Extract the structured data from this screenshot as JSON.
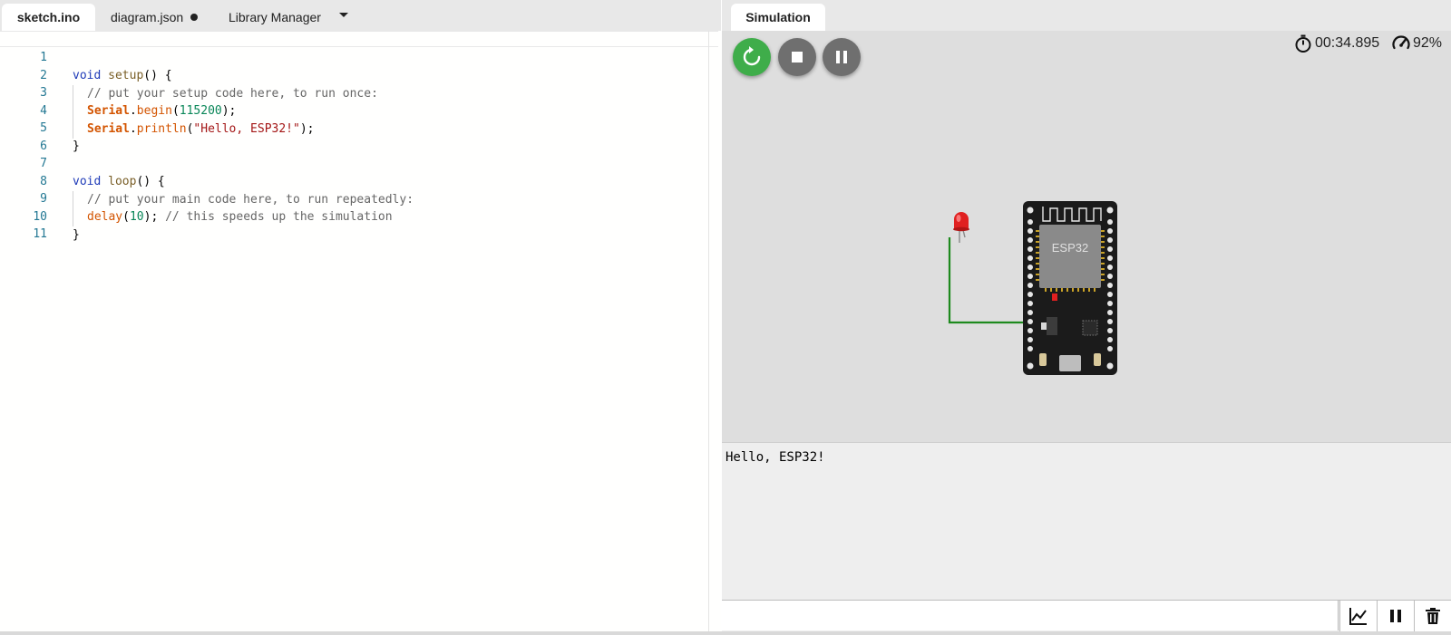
{
  "editor": {
    "tabs": [
      {
        "label": "sketch.ino"
      },
      {
        "label": "diagram.json"
      },
      {
        "label": "Library Manager"
      }
    ],
    "lines": [
      {
        "n": "1"
      },
      {
        "n": "2"
      },
      {
        "n": "3"
      },
      {
        "n": "4"
      },
      {
        "n": "5"
      },
      {
        "n": "6"
      },
      {
        "n": "7"
      },
      {
        "n": "8"
      },
      {
        "n": "9"
      },
      {
        "n": "10"
      },
      {
        "n": "11"
      }
    ],
    "code": {
      "l1_kw": "void",
      "l1_fn": "setup",
      "l1_rest": "() {",
      "l2_comment": "// put your setup code here, to run once:",
      "l3_class": "Serial",
      "l3_dot": ".",
      "l3_method": "begin",
      "l3_open": "(",
      "l3_num": "115200",
      "l3_close": ");",
      "l4_class": "Serial",
      "l4_dot": ".",
      "l4_method": "println",
      "l4_open": "(",
      "l4_str": "\"Hello, ESP32!\"",
      "l4_close": ");",
      "l5": "}",
      "l7_kw": "void",
      "l7_fn": "loop",
      "l7_rest": "() {",
      "l8_comment": "// put your main code here, to run repeatedly:",
      "l9_fn": "delay",
      "l9_open": "(",
      "l9_num": "10",
      "l9_close": ");",
      "l9_comment": " // this speeds up the simulation",
      "l10": "}"
    }
  },
  "simulation": {
    "tab_label": "Simulation",
    "timer": "00:34.895",
    "speed": "92%",
    "board_label": "ESP32",
    "serial_output": "Hello, ESP32!",
    "serial_input_value": "",
    "colors": {
      "restart": "#3fad4a",
      "control": "#6f6f6f",
      "wire": "#1e8a1e",
      "led": "#e02020"
    }
  }
}
